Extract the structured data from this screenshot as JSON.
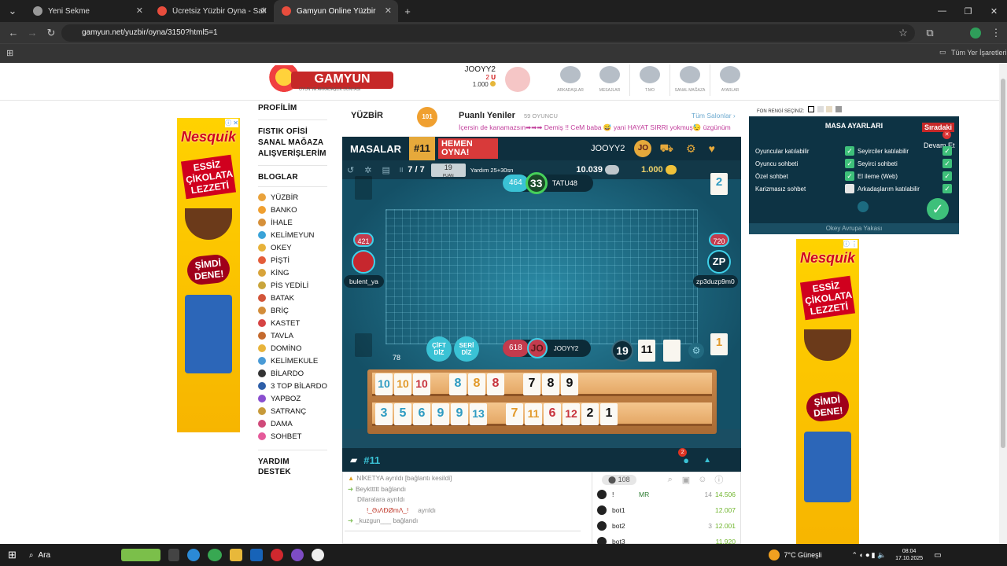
{
  "browser": {
    "tabs": [
      {
        "title": "Yeni Sekme"
      },
      {
        "title": "Ücretsiz Yüzbir Oyna - Salon Li..."
      },
      {
        "title": "Gamyun Online Yüzbir"
      }
    ],
    "url": "gamyun.net/yuzbir/oyna/3150?html5=1",
    "bookmarks_label": "Tüm Yer İşaretleri"
  },
  "header": {
    "logo_text": "GAMYUN",
    "logo_slogan": "OYUN VE ARKADAŞLIK DÜNYASI",
    "username": "JOOYY2",
    "level": "2",
    "coins": "1.000",
    "nav": [
      "ARKADAŞLAR",
      "MESAJLAR",
      "T.MO",
      "SANAL MAĞAZA",
      "AYARLAR"
    ]
  },
  "ads": {
    "brand": "Nesquik",
    "slogan": "ESSİZ ÇİKOLATA LEZZETİ",
    "cta": "ŞİMDİ DENE!",
    "tag": "ⓘ ✕"
  },
  "sidebar": {
    "profile": "PROFİLİM",
    "links": [
      "FISTIK OFİSİ",
      "SANAL MAĞAZA",
      "ALIŞVERİŞLERİM"
    ],
    "blogs": "BLOGLAR",
    "games": [
      {
        "name": "YÜZBİR",
        "color": "#e9a23b"
      },
      {
        "name": "BANKO",
        "color": "#f0a030"
      },
      {
        "name": "İHALE",
        "color": "#d6903a"
      },
      {
        "name": "KELİMEYUN",
        "color": "#3aa3d8"
      },
      {
        "name": "OKEY",
        "color": "#e7b23a"
      },
      {
        "name": "PİŞTİ",
        "color": "#e45d3a"
      },
      {
        "name": "KİNG",
        "color": "#d8a43a"
      },
      {
        "name": "PİS YEDİLİ",
        "color": "#c9a53b"
      },
      {
        "name": "BATAK",
        "color": "#d2553a"
      },
      {
        "name": "BRİÇ",
        "color": "#d38d3a"
      },
      {
        "name": "KASTET",
        "color": "#d64444"
      },
      {
        "name": "TAVLA",
        "color": "#c46a2e"
      },
      {
        "name": "DOMİNO",
        "color": "#e8b43b"
      },
      {
        "name": "KELİMEKULE",
        "color": "#4a9bd6"
      },
      {
        "name": "BİLARDO",
        "color": "#333333"
      },
      {
        "name": "3 TOP BİLARDO",
        "color": "#2e5fa8"
      },
      {
        "name": "YAPBOZ",
        "color": "#8a4fcf"
      },
      {
        "name": "SATRANÇ",
        "color": "#c79a3a"
      },
      {
        "name": "DAMA",
        "color": "#d04a7a"
      },
      {
        "name": "SOHBET",
        "color": "#e55a9a"
      }
    ],
    "help": "YARDIM",
    "support": "DESTEK"
  },
  "rooms": {
    "game": "YÜZBİR",
    "badge": "101",
    "section": "Puanlı Yeniler",
    "players": "59 OYUNCU",
    "all_rooms": "Tüm Salonlar ›",
    "ticker": "İçersin de kanamazsın➡➡➡ Demiş !! CeM baba 😅 yani HAYAT SIRRI yokmuş😓 üzgünüm"
  },
  "game": {
    "masalar": "MASALAR",
    "table_num": "#11",
    "hemen": "HEMEN OYNA!",
    "player": "JOOYY2",
    "player_badge": "JO",
    "round": "7 / 7",
    "points": "19",
    "points_label": "PUAN",
    "help": "Yardım 25+30sn",
    "score_left": "10.039",
    "score_right": "1.000",
    "top": {
      "score": "464",
      "timer": "33",
      "name": "TATU48",
      "card": "2"
    },
    "left": {
      "score": "421",
      "name": "bulent_ya"
    },
    "right": {
      "score": "720",
      "name": "zp3duzp9m0",
      "badge": "ZP"
    },
    "me": {
      "score": "618",
      "badge": "JO",
      "name": "JOOYY2",
      "card": "1"
    },
    "buttons": {
      "cift": "ÇİFT DİZ",
      "seri": "SERİ DİZ"
    },
    "remaining": "78",
    "open_total": "19",
    "indicator": "11",
    "rack_top": [
      {
        "v": "10",
        "c": "#2e9bc2"
      },
      {
        "v": "10",
        "c": "#e29a2c"
      },
      {
        "v": "10",
        "c": "#c8343e"
      },
      {
        "v": "8",
        "c": "#2e9bc2"
      },
      {
        "v": "8",
        "c": "#e29a2c"
      },
      {
        "v": "8",
        "c": "#c8343e"
      },
      {
        "v": "7",
        "c": "#111111"
      },
      {
        "v": "8",
        "c": "#111111"
      },
      {
        "v": "9",
        "c": "#111111"
      }
    ],
    "rack_bottom": [
      {
        "v": "3",
        "c": "#2e9bc2"
      },
      {
        "v": "5",
        "c": "#2e9bc2"
      },
      {
        "v": "6",
        "c": "#2e9bc2"
      },
      {
        "v": "9",
        "c": "#2e9bc2"
      },
      {
        "v": "9",
        "c": "#2e9bc2"
      },
      {
        "v": "13",
        "c": "#2e9bc2"
      },
      {
        "v": "7",
        "c": "#e29a2c"
      },
      {
        "v": "11",
        "c": "#e29a2c"
      },
      {
        "v": "6",
        "c": "#c8343e"
      },
      {
        "v": "12",
        "c": "#c8343e"
      },
      {
        "v": "2",
        "c": "#111111"
      },
      {
        "v": "1",
        "c": "#111111"
      }
    ],
    "bottom_table": "#11",
    "notif": "2",
    "notice": "1"
  },
  "chat": {
    "lines": [
      "NİKETYA ayrıldı [bağlantı kesildi]",
      "Beykttttt bağlandı",
      "Dilaralara ayrıldı",
      "!_ƏɹΛÐØmΛ_!",
      "ayrıldı",
      "_kuzgun___ bağlandı"
    ],
    "online": "108",
    "players": [
      {
        "name": "!",
        "tag": "MR",
        "n": "14",
        "gold": "14.506"
      },
      {
        "name": "bot1",
        "tag": "",
        "n": "",
        "gold": "12.007"
      },
      {
        "name": "bot2",
        "tag": "",
        "n": "3",
        "gold": "12.001"
      },
      {
        "name": "bot3",
        "tag": "",
        "n": "",
        "gold": "11.920"
      }
    ]
  },
  "settings": {
    "color_label": "FON RENGİ SEÇİNİZ:",
    "title": "MASA AYARLARI",
    "next": "Sıradaki",
    "cont": "Devam Et",
    "rows": [
      "Oyuncular katılabilir",
      "Oyuncu sohbeti",
      "Özel sohbet",
      "Karizmasız sohbet",
      "Seyirciler katılabilir",
      "Seyirci sohbeti",
      "El ileme (Web)",
      "Arkadaşlarım katılabilir"
    ],
    "checked": [
      true,
      true,
      true,
      false,
      true,
      true,
      true,
      true
    ],
    "footer": "Okey Avrupa Yakası"
  },
  "taskbar": {
    "search": "Ara",
    "weather": "7°C Güneşli",
    "time": "08:04",
    "date": "17.10.2025"
  }
}
